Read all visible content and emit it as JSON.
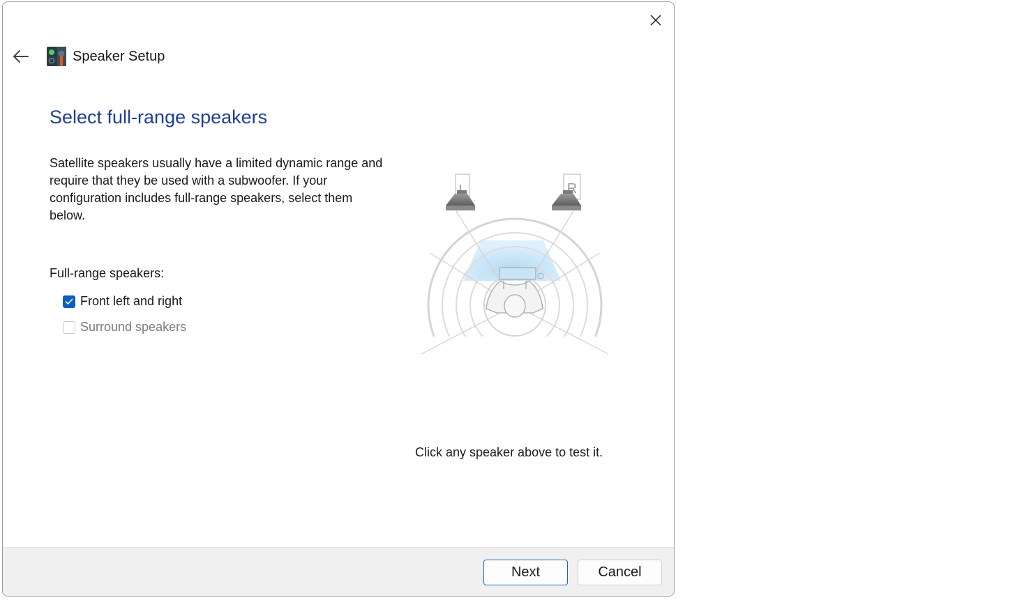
{
  "window": {
    "title": "Speaker Setup",
    "close_icon": "close-icon",
    "back_icon": "back-arrow-icon",
    "app_icon": "speaker-setup-app-icon"
  },
  "page": {
    "title": "Select full-range speakers",
    "description": "Satellite speakers usually have a limited dynamic range and require that they be used with a subwoofer.  If your configuration includes full-range speakers, select them below.",
    "group_label": "Full-range speakers:",
    "options": [
      {
        "label": "Front left and right",
        "checked": true,
        "enabled": true
      },
      {
        "label": "Surround speakers",
        "checked": false,
        "enabled": false
      }
    ]
  },
  "diagram": {
    "left_speaker_label": "L",
    "right_speaker_label": "R",
    "hint": "Click any speaker above to test it."
  },
  "footer": {
    "next_label": "Next",
    "cancel_label": "Cancel"
  },
  "colors": {
    "accent": "#0a5ec2",
    "title": "#1f3f94",
    "footer_bg": "#f0f0f0"
  }
}
